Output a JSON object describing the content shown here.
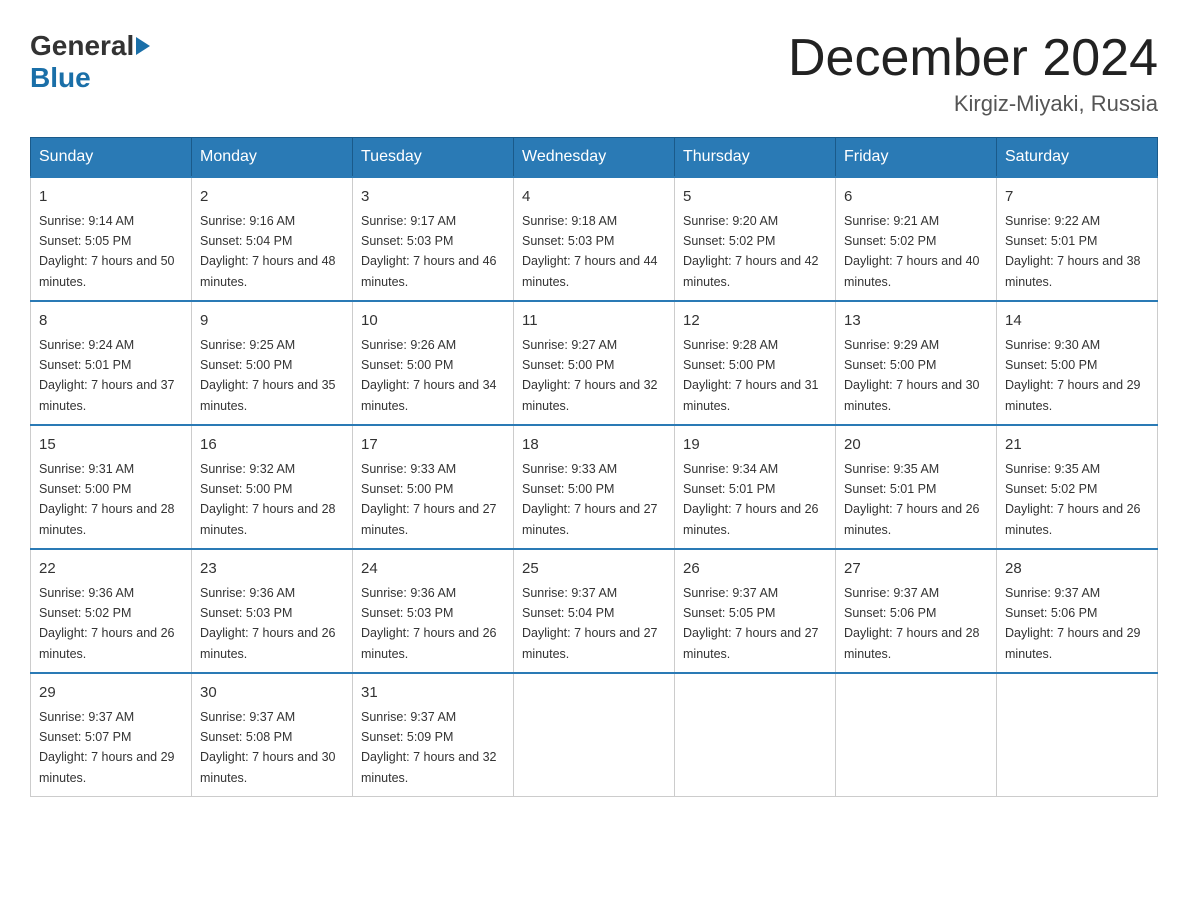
{
  "header": {
    "logo_general": "General",
    "logo_blue": "Blue",
    "month_title": "December 2024",
    "location": "Kirgiz-Miyaki, Russia"
  },
  "calendar": {
    "days_of_week": [
      "Sunday",
      "Monday",
      "Tuesday",
      "Wednesday",
      "Thursday",
      "Friday",
      "Saturday"
    ],
    "weeks": [
      [
        {
          "day": "1",
          "sunrise": "9:14 AM",
          "sunset": "5:05 PM",
          "daylight": "7 hours and 50 minutes."
        },
        {
          "day": "2",
          "sunrise": "9:16 AM",
          "sunset": "5:04 PM",
          "daylight": "7 hours and 48 minutes."
        },
        {
          "day": "3",
          "sunrise": "9:17 AM",
          "sunset": "5:03 PM",
          "daylight": "7 hours and 46 minutes."
        },
        {
          "day": "4",
          "sunrise": "9:18 AM",
          "sunset": "5:03 PM",
          "daylight": "7 hours and 44 minutes."
        },
        {
          "day": "5",
          "sunrise": "9:20 AM",
          "sunset": "5:02 PM",
          "daylight": "7 hours and 42 minutes."
        },
        {
          "day": "6",
          "sunrise": "9:21 AM",
          "sunset": "5:02 PM",
          "daylight": "7 hours and 40 minutes."
        },
        {
          "day": "7",
          "sunrise": "9:22 AM",
          "sunset": "5:01 PM",
          "daylight": "7 hours and 38 minutes."
        }
      ],
      [
        {
          "day": "8",
          "sunrise": "9:24 AM",
          "sunset": "5:01 PM",
          "daylight": "7 hours and 37 minutes."
        },
        {
          "day": "9",
          "sunrise": "9:25 AM",
          "sunset": "5:00 PM",
          "daylight": "7 hours and 35 minutes."
        },
        {
          "day": "10",
          "sunrise": "9:26 AM",
          "sunset": "5:00 PM",
          "daylight": "7 hours and 34 minutes."
        },
        {
          "day": "11",
          "sunrise": "9:27 AM",
          "sunset": "5:00 PM",
          "daylight": "7 hours and 32 minutes."
        },
        {
          "day": "12",
          "sunrise": "9:28 AM",
          "sunset": "5:00 PM",
          "daylight": "7 hours and 31 minutes."
        },
        {
          "day": "13",
          "sunrise": "9:29 AM",
          "sunset": "5:00 PM",
          "daylight": "7 hours and 30 minutes."
        },
        {
          "day": "14",
          "sunrise": "9:30 AM",
          "sunset": "5:00 PM",
          "daylight": "7 hours and 29 minutes."
        }
      ],
      [
        {
          "day": "15",
          "sunrise": "9:31 AM",
          "sunset": "5:00 PM",
          "daylight": "7 hours and 28 minutes."
        },
        {
          "day": "16",
          "sunrise": "9:32 AM",
          "sunset": "5:00 PM",
          "daylight": "7 hours and 28 minutes."
        },
        {
          "day": "17",
          "sunrise": "9:33 AM",
          "sunset": "5:00 PM",
          "daylight": "7 hours and 27 minutes."
        },
        {
          "day": "18",
          "sunrise": "9:33 AM",
          "sunset": "5:00 PM",
          "daylight": "7 hours and 27 minutes."
        },
        {
          "day": "19",
          "sunrise": "9:34 AM",
          "sunset": "5:01 PM",
          "daylight": "7 hours and 26 minutes."
        },
        {
          "day": "20",
          "sunrise": "9:35 AM",
          "sunset": "5:01 PM",
          "daylight": "7 hours and 26 minutes."
        },
        {
          "day": "21",
          "sunrise": "9:35 AM",
          "sunset": "5:02 PM",
          "daylight": "7 hours and 26 minutes."
        }
      ],
      [
        {
          "day": "22",
          "sunrise": "9:36 AM",
          "sunset": "5:02 PM",
          "daylight": "7 hours and 26 minutes."
        },
        {
          "day": "23",
          "sunrise": "9:36 AM",
          "sunset": "5:03 PM",
          "daylight": "7 hours and 26 minutes."
        },
        {
          "day": "24",
          "sunrise": "9:36 AM",
          "sunset": "5:03 PM",
          "daylight": "7 hours and 26 minutes."
        },
        {
          "day": "25",
          "sunrise": "9:37 AM",
          "sunset": "5:04 PM",
          "daylight": "7 hours and 27 minutes."
        },
        {
          "day": "26",
          "sunrise": "9:37 AM",
          "sunset": "5:05 PM",
          "daylight": "7 hours and 27 minutes."
        },
        {
          "day": "27",
          "sunrise": "9:37 AM",
          "sunset": "5:06 PM",
          "daylight": "7 hours and 28 minutes."
        },
        {
          "day": "28",
          "sunrise": "9:37 AM",
          "sunset": "5:06 PM",
          "daylight": "7 hours and 29 minutes."
        }
      ],
      [
        {
          "day": "29",
          "sunrise": "9:37 AM",
          "sunset": "5:07 PM",
          "daylight": "7 hours and 29 minutes."
        },
        {
          "day": "30",
          "sunrise": "9:37 AM",
          "sunset": "5:08 PM",
          "daylight": "7 hours and 30 minutes."
        },
        {
          "day": "31",
          "sunrise": "9:37 AM",
          "sunset": "5:09 PM",
          "daylight": "7 hours and 32 minutes."
        },
        null,
        null,
        null,
        null
      ]
    ]
  }
}
